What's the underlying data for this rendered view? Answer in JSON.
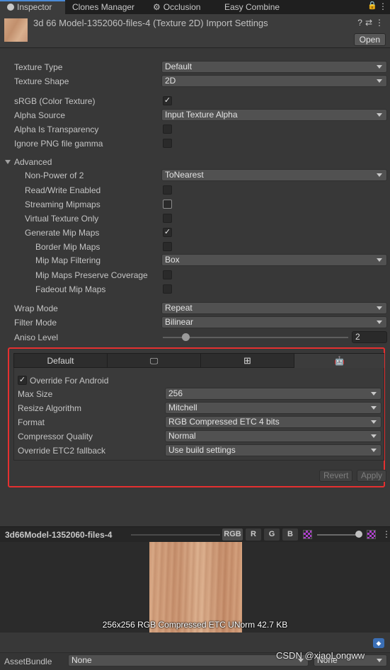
{
  "tabs": [
    {
      "label": "Inspector",
      "icon": "info-icon"
    },
    {
      "label": "Clones Manager"
    },
    {
      "label": "Occlusion",
      "icon": "gear-icon"
    },
    {
      "label": "Easy Combine"
    }
  ],
  "header": {
    "title": "3d 66 Model-1352060-files-4 (Texture 2D) Import Settings",
    "open_label": "Open"
  },
  "fields": {
    "texture_type": {
      "label": "Texture Type",
      "value": "Default"
    },
    "texture_shape": {
      "label": "Texture Shape",
      "value": "2D"
    },
    "srgb": {
      "label": "sRGB (Color Texture)",
      "checked": true
    },
    "alpha_source": {
      "label": "Alpha Source",
      "value": "Input Texture Alpha"
    },
    "alpha_is_transparency": {
      "label": "Alpha Is Transparency",
      "checked": false
    },
    "ignore_png_gamma": {
      "label": "Ignore PNG file gamma",
      "checked": false
    },
    "advanced": {
      "label": "Advanced",
      "expanded": true
    },
    "non_power_of_2": {
      "label": "Non-Power of 2",
      "value": "ToNearest"
    },
    "read_write": {
      "label": "Read/Write Enabled",
      "checked": false
    },
    "streaming_mipmaps": {
      "label": "Streaming Mipmaps",
      "checked": false
    },
    "virtual_texture_only": {
      "label": "Virtual Texture Only",
      "checked": false
    },
    "generate_mip_maps": {
      "label": "Generate Mip Maps",
      "checked": true
    },
    "border_mip_maps": {
      "label": "Border Mip Maps",
      "checked": false
    },
    "mip_map_filtering": {
      "label": "Mip Map Filtering",
      "value": "Box"
    },
    "mip_maps_preserve_coverage": {
      "label": "Mip Maps Preserve Coverage",
      "checked": false
    },
    "fadeout_mip_maps": {
      "label": "Fadeout Mip Maps",
      "checked": false
    },
    "wrap_mode": {
      "label": "Wrap Mode",
      "value": "Repeat"
    },
    "filter_mode": {
      "label": "Filter Mode",
      "value": "Bilinear"
    },
    "aniso_level": {
      "label": "Aniso Level",
      "value": "2",
      "slider_fraction": 0.125
    }
  },
  "platform": {
    "tabs": [
      {
        "label": "Default",
        "icon": null
      },
      {
        "label": "",
        "icon": "monitor-icon"
      },
      {
        "label": "",
        "icon": "windows-icon"
      },
      {
        "label": "",
        "icon": "android-icon",
        "active": true
      }
    ],
    "override": {
      "label": "Override For Android",
      "checked": true
    },
    "max_size": {
      "label": "Max Size",
      "value": "256"
    },
    "resize_algorithm": {
      "label": "Resize Algorithm",
      "value": "Mitchell"
    },
    "format": {
      "label": "Format",
      "value": "RGB Compressed ETC 4 bits"
    },
    "compressor_quality": {
      "label": "Compressor Quality",
      "value": "Normal"
    },
    "etc2_fallback": {
      "label": "Override ETC2 fallback",
      "value": "Use build settings"
    },
    "revert_label": "Revert",
    "apply_label": "Apply"
  },
  "preview": {
    "title": "3d66Model-1352060-files-4",
    "channels": [
      "RGB",
      "R",
      "G",
      "B"
    ],
    "info": "256x256  RGB Compressed ETC UNorm   42.7 KB"
  },
  "asset_bundle": {
    "label": "AssetBundle",
    "value": "None",
    "variant": "None"
  },
  "watermark": "CSDN @xiaoLongww",
  "colors": {
    "highlight_box": "#e53030",
    "active_tab_accent": "#4a8ad6"
  }
}
